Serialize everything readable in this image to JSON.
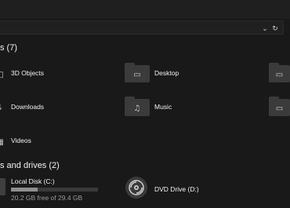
{
  "sections": {
    "folders_title": "s (7)",
    "drives_title": "s and drives (2)"
  },
  "folders": [
    {
      "label": "3D Objects",
      "icon": "cube-icon"
    },
    {
      "label": "Desktop",
      "icon": "monitor-icon"
    },
    {
      "label": "Downloads",
      "icon": "download-arrow-icon"
    },
    {
      "label": "Music",
      "icon": "music-note-icon"
    },
    {
      "label": "Videos",
      "icon": "film-icon"
    }
  ],
  "drives": [
    {
      "label": "Local Disk (C:)",
      "free_text": "20.2 GB free of 29.4 GB",
      "used_fraction": 0.31
    },
    {
      "label": "DVD Drive (D:)"
    }
  ],
  "colors": {
    "background": "#191919",
    "folder": "#3b3b3b",
    "bar_fill": "#8e8e8e",
    "text": "#ffffff"
  }
}
